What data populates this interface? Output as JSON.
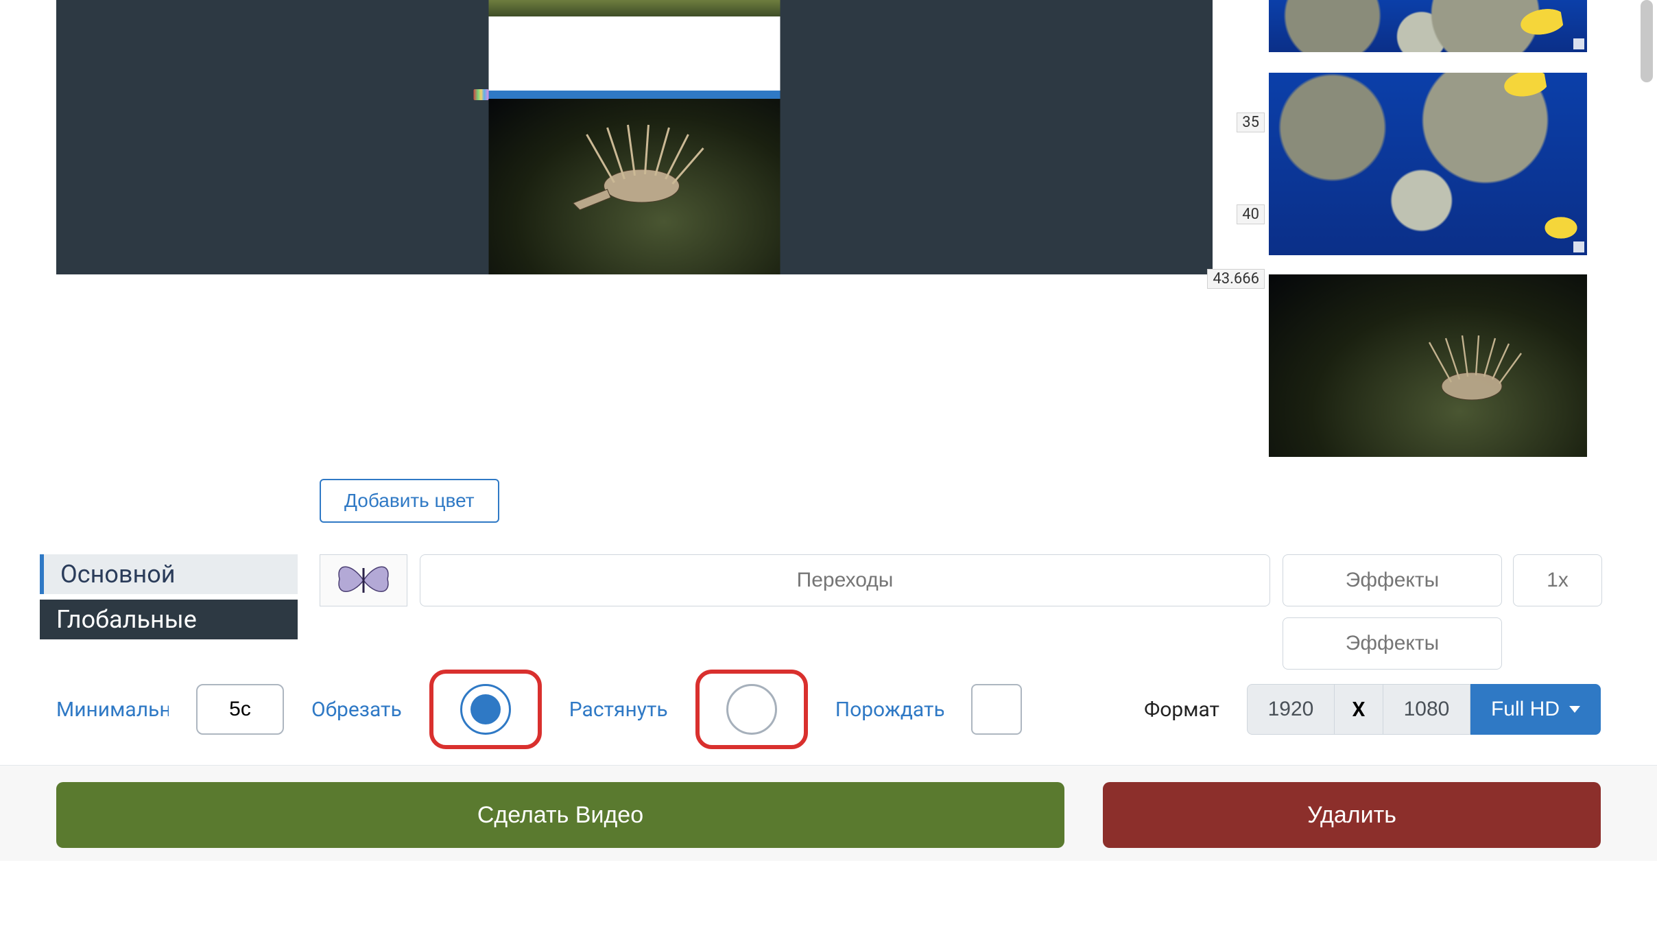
{
  "preview": {
    "ticks": [
      "35",
      "40",
      "43.666"
    ]
  },
  "add_color_label": "Добавить цвет",
  "tabs": {
    "main": "Основной",
    "global": "Глобальные"
  },
  "transitions_placeholder": "Переходы",
  "effects_placeholder": "Эффекты",
  "speed_placeholder": "1x",
  "settings": {
    "min_label": "Минимальн",
    "duration_value": "5с",
    "crop_label": "Обрезать",
    "stretch_label": "Растянуть",
    "generate_label": "Порождать",
    "crop_selected": true,
    "stretch_selected": false,
    "generate_checked": false,
    "format_label": "Формат",
    "width": "1920",
    "height": "1080",
    "dim_sep": "X",
    "preset_label": "Full HD"
  },
  "actions": {
    "make": "Сделать Видео",
    "delete": "Удалить"
  }
}
